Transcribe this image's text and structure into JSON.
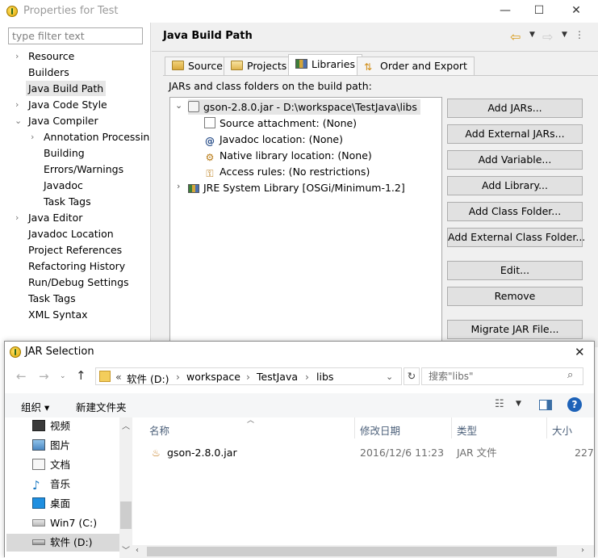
{
  "props_window": {
    "title": "Properties for Test",
    "caption": {
      "minimize": "—",
      "maximize": "☐",
      "close": "✕"
    },
    "filter_placeholder": "type filter text",
    "nav_items": [
      {
        "label": "Resource",
        "expandable": true
      },
      {
        "label": "Builders",
        "expandable": false
      },
      {
        "label": "Java Build Path",
        "expandable": false,
        "selected": true
      },
      {
        "label": "Java Code Style",
        "expandable": true
      },
      {
        "label": "Java Compiler",
        "expandable": true,
        "expanded": true
      },
      {
        "label": "Annotation Processin",
        "expandable": true,
        "child": true
      },
      {
        "label": "Building",
        "child": true
      },
      {
        "label": "Errors/Warnings",
        "child": true
      },
      {
        "label": "Javadoc",
        "child": true
      },
      {
        "label": "Task Tags",
        "child": true
      },
      {
        "label": "Java Editor",
        "expandable": true
      },
      {
        "label": "Javadoc Location"
      },
      {
        "label": "Project References"
      },
      {
        "label": "Refactoring History"
      },
      {
        "label": "Run/Debug Settings"
      },
      {
        "label": "Task Tags"
      },
      {
        "label": "XML Syntax"
      }
    ],
    "page_title": "Java Build Path",
    "tabs": [
      {
        "label": "Source",
        "icon": "source-folder-icon"
      },
      {
        "label": "Projects",
        "icon": "projects-icon"
      },
      {
        "label": "Libraries",
        "icon": "libraries-icon",
        "active": true
      },
      {
        "label": "Order and Export",
        "icon": "order-export-icon"
      }
    ],
    "jars_label": "JARs and class folders on the build path:",
    "tree": {
      "jar": "gson-2.8.0.jar - D:\\workspace\\TestJava\\libs",
      "children": [
        "Source attachment: (None)",
        "Javadoc location: (None)",
        "Native library location: (None)",
        "Access rules: (No restrictions)"
      ],
      "jre": "JRE System Library [OSGi/Minimum-1.2]"
    },
    "buttons": [
      "Add JARs...",
      "Add External JARs...",
      "Add Variable...",
      "Add Library...",
      "Add Class Folder...",
      "Add External Class Folder...",
      "Edit...",
      "Remove",
      "Migrate JAR File..."
    ]
  },
  "jar_dialog": {
    "title": "JAR Selection",
    "close": "✕",
    "breadcrumb": [
      "«",
      "软件 (D:)",
      "›",
      "workspace",
      "›",
      "TestJava",
      "›",
      "libs"
    ],
    "search_placeholder": "搜索\"libs\"",
    "organize": "组织 ▾",
    "new_folder": "新建文件夹",
    "help": "?",
    "nav_items": [
      {
        "label": "视频",
        "icon": "video-folder-icon"
      },
      {
        "label": "图片",
        "icon": "pictures-folder-icon"
      },
      {
        "label": "文档",
        "icon": "documents-folder-icon"
      },
      {
        "label": "音乐",
        "icon": "music-folder-icon"
      },
      {
        "label": "桌面",
        "icon": "desktop-folder-icon"
      },
      {
        "label": "Win7 (C:)",
        "icon": "drive-icon"
      },
      {
        "label": "软件 (D:)",
        "icon": "drive-icon",
        "selected": true
      }
    ],
    "columns": [
      "名称",
      "修改日期",
      "类型",
      "大小"
    ],
    "files": [
      {
        "name": "gson-2.8.0.jar",
        "date": "2016/12/6 11:23",
        "type": "JAR 文件",
        "size": "227"
      }
    ]
  },
  "colors": {
    "accent": "#0078d7",
    "button_face": "#e1e1e1",
    "selection": "#e5e5e5"
  }
}
